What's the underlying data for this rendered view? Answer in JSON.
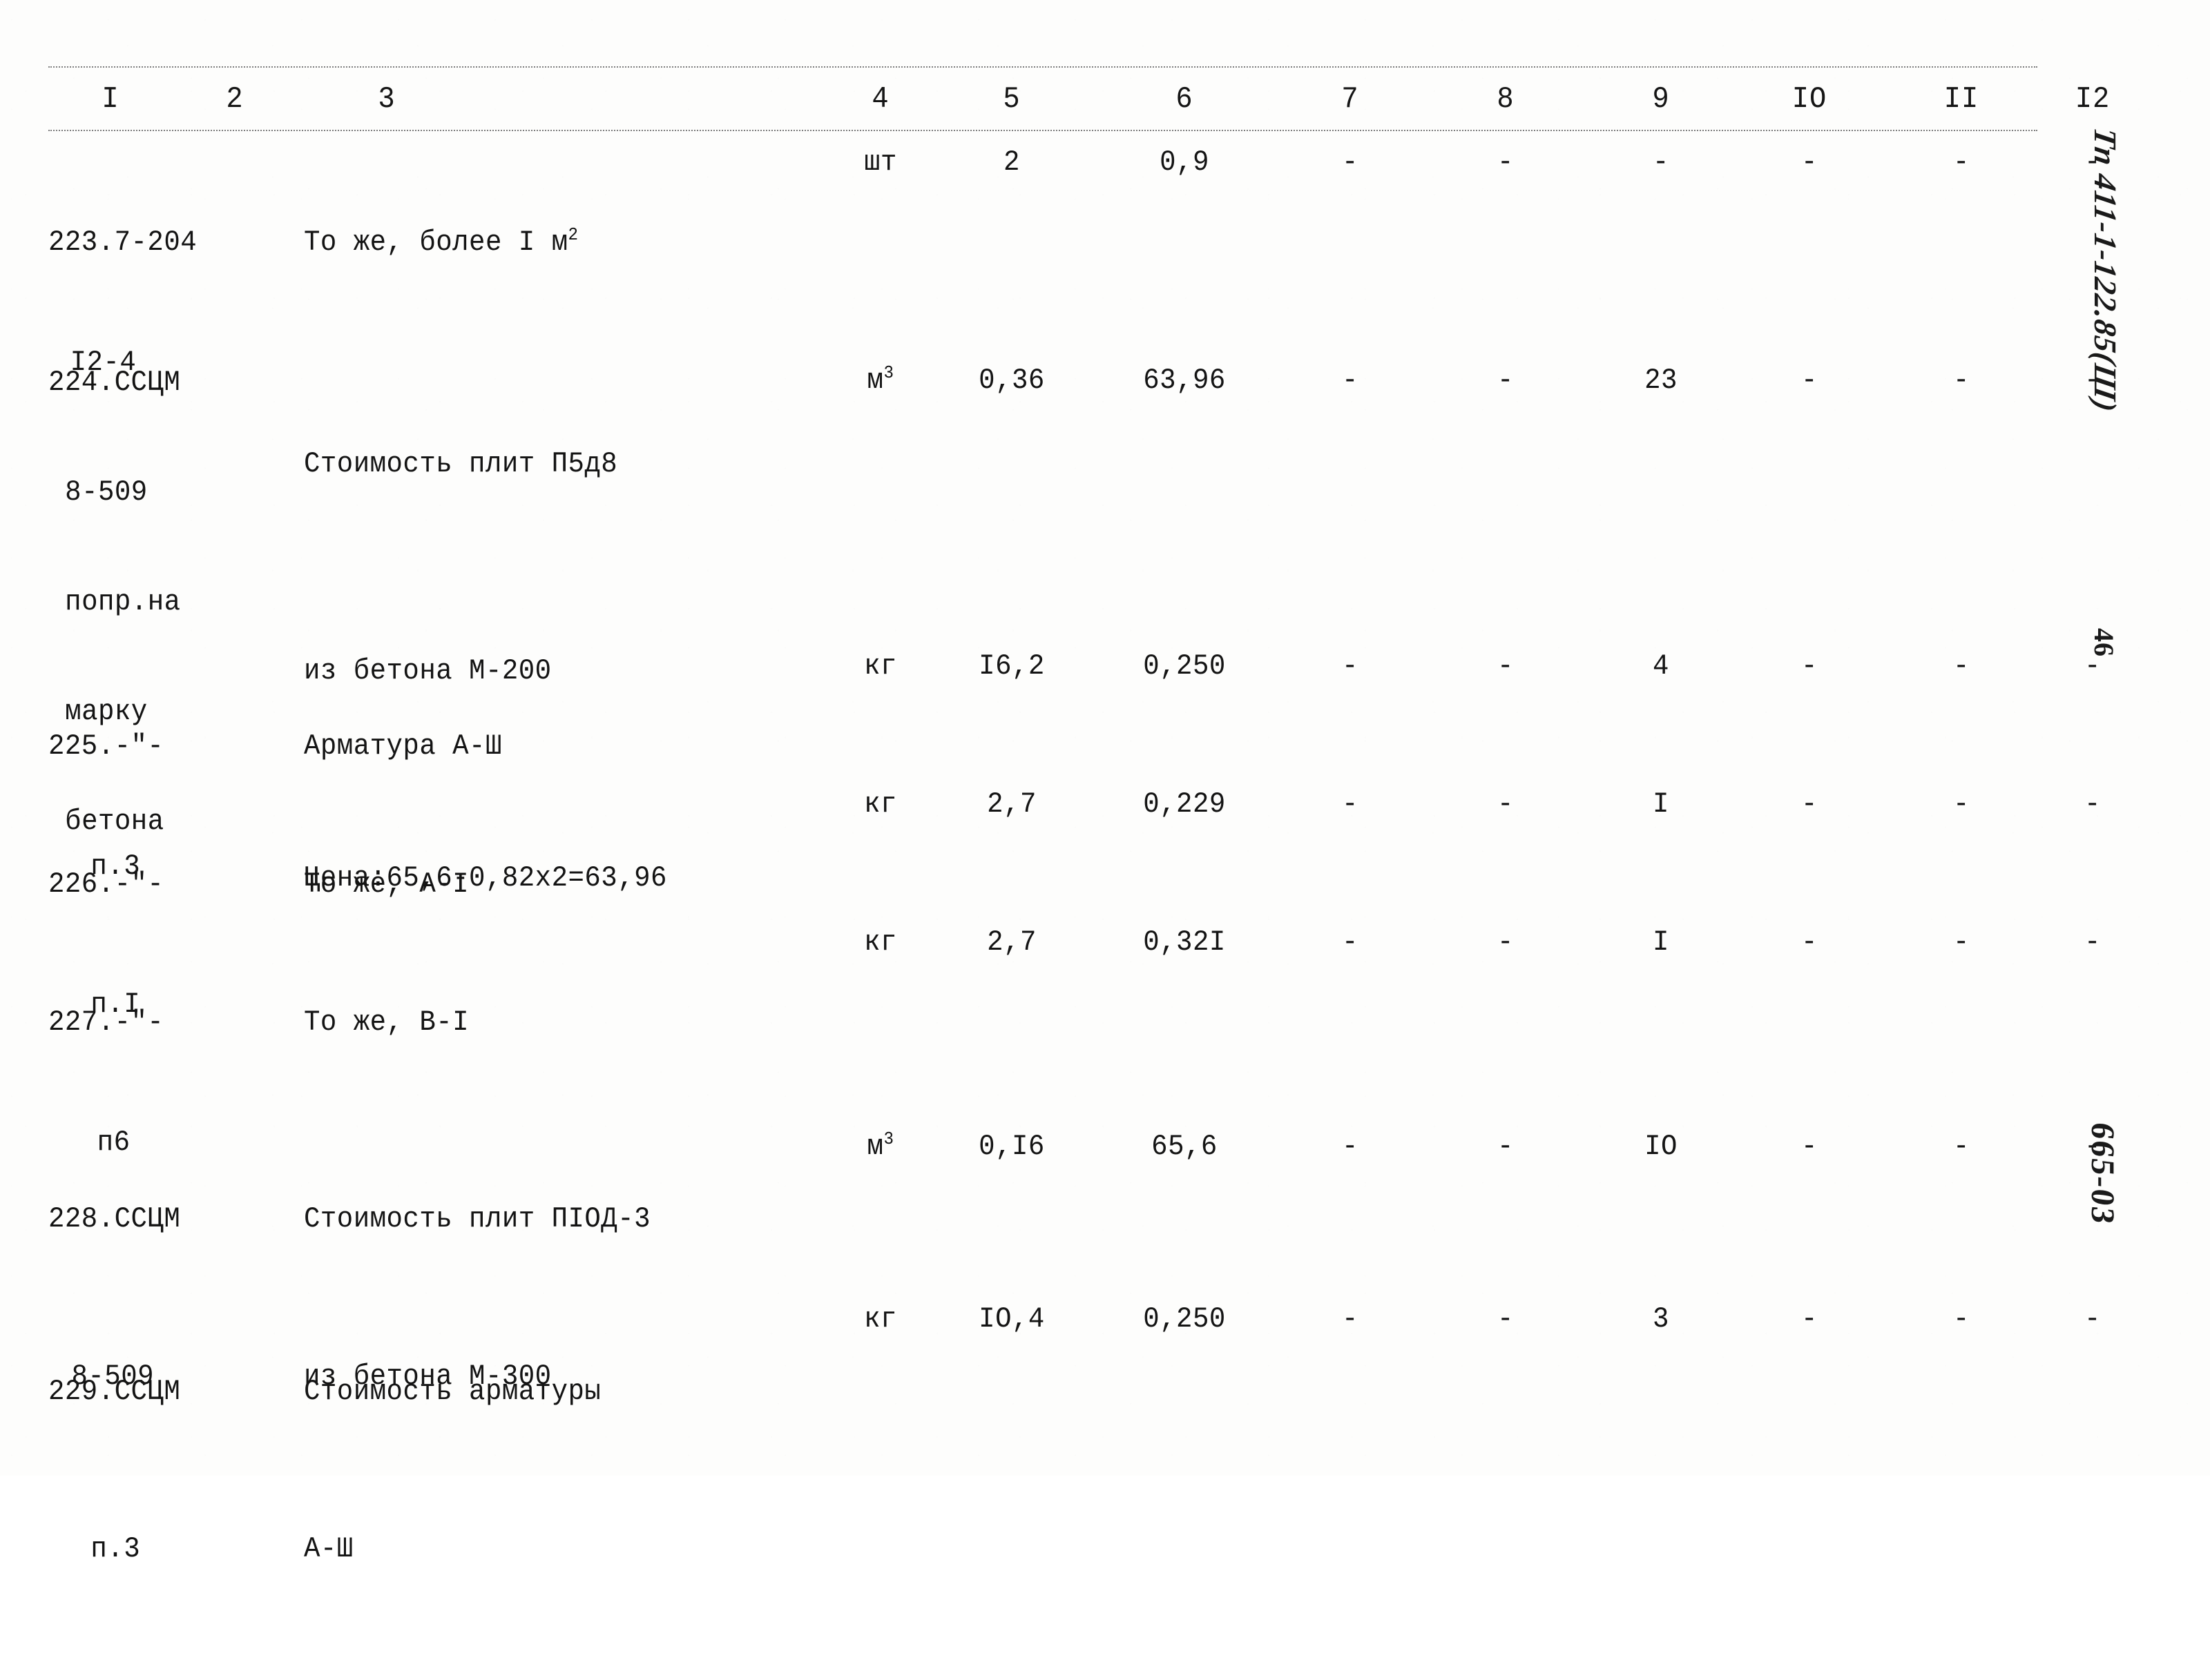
{
  "document": {
    "type": "scanned-cost-estimate-table",
    "language": "ru"
  },
  "table": {
    "column_headers": [
      "I",
      "2",
      "3",
      "4",
      "5",
      "6",
      "7",
      "8",
      "9",
      "IO",
      "II",
      "I2"
    ],
    "rows": [
      {
        "code_line1": "223.7-204",
        "code_line2": "I2-4",
        "name_line1": "То же, более I м",
        "name_sup1": "2",
        "name_line2": "",
        "name_line3": "",
        "unit": "шт",
        "qty": "2",
        "price": "0,9",
        "c7": "-",
        "c8": "-",
        "c9": "-",
        "c10": "-",
        "c11": "-",
        "c12": "-"
      },
      {
        "code_line1": "224.ССЦМ",
        "code_line2": "8-509",
        "code_line3": "попр.на",
        "code_line4": "марку",
        "code_line5": "бетона",
        "name_line1": "Стоимость плит П5д8",
        "name_line2": "из бетона М-200",
        "name_line3": "Цена:65,6-0,82х2=63,96",
        "unit": "м",
        "unit_sup": "3",
        "qty": "0,36",
        "price": "63,96",
        "c7": "-",
        "c8": "-",
        "c9": "23",
        "c10": "-",
        "c11": "-",
        "c12": "-"
      },
      {
        "code_line1": "225.-\"-",
        "code_line2": "п.3",
        "name_line1": "Арматура А-Ш",
        "unit": "кг",
        "qty": "I6,2",
        "price": "0,250",
        "c7": "-",
        "c8": "-",
        "c9": "4",
        "c10": "-",
        "c11": "-",
        "c12": "-"
      },
      {
        "code_line1": "226.-\"-",
        "code_line2": "п.I",
        "name_line1": "То же, А-I",
        "unit": "кг",
        "qty": "2,7",
        "price": "0,229",
        "c7": "-",
        "c8": "-",
        "c9": "I",
        "c10": "-",
        "c11": "-",
        "c12": "-"
      },
      {
        "code_line1": "227.-\"-",
        "code_line2": "п6",
        "name_line1": "То же, В-I",
        "unit": "кг",
        "qty": "2,7",
        "price": "0,32I",
        "c7": "-",
        "c8": "-",
        "c9": "I",
        "c10": "-",
        "c11": "-",
        "c12": "-"
      },
      {
        "code_line1": "228.ССЦМ",
        "code_line2": "8-509",
        "name_line1": "Стоимость плит ПIOД-3",
        "name_line2": "из бетона М-300",
        "unit": "м",
        "unit_sup": "3",
        "qty": "0,I6",
        "price": "65,6",
        "c7": "-",
        "c8": "-",
        "c9": "IO",
        "c10": "-",
        "c11": "-",
        "c12": "-"
      },
      {
        "code_line1": "229.ССЦМ",
        "code_line2": "п.3",
        "name_line1": "Стоимость арматуры",
        "name_line2": "А-Ш",
        "unit": "кг",
        "qty": "IO,4",
        "price": "0,250",
        "c7": "-",
        "c8": "-",
        "c9": "3",
        "c10": "-",
        "c11": "-",
        "c12": "-"
      }
    ]
  },
  "margin_notes": {
    "series_code": "Тп 411-1-122.85(Ш)",
    "page_number": "46",
    "archive_code": "665-03"
  }
}
